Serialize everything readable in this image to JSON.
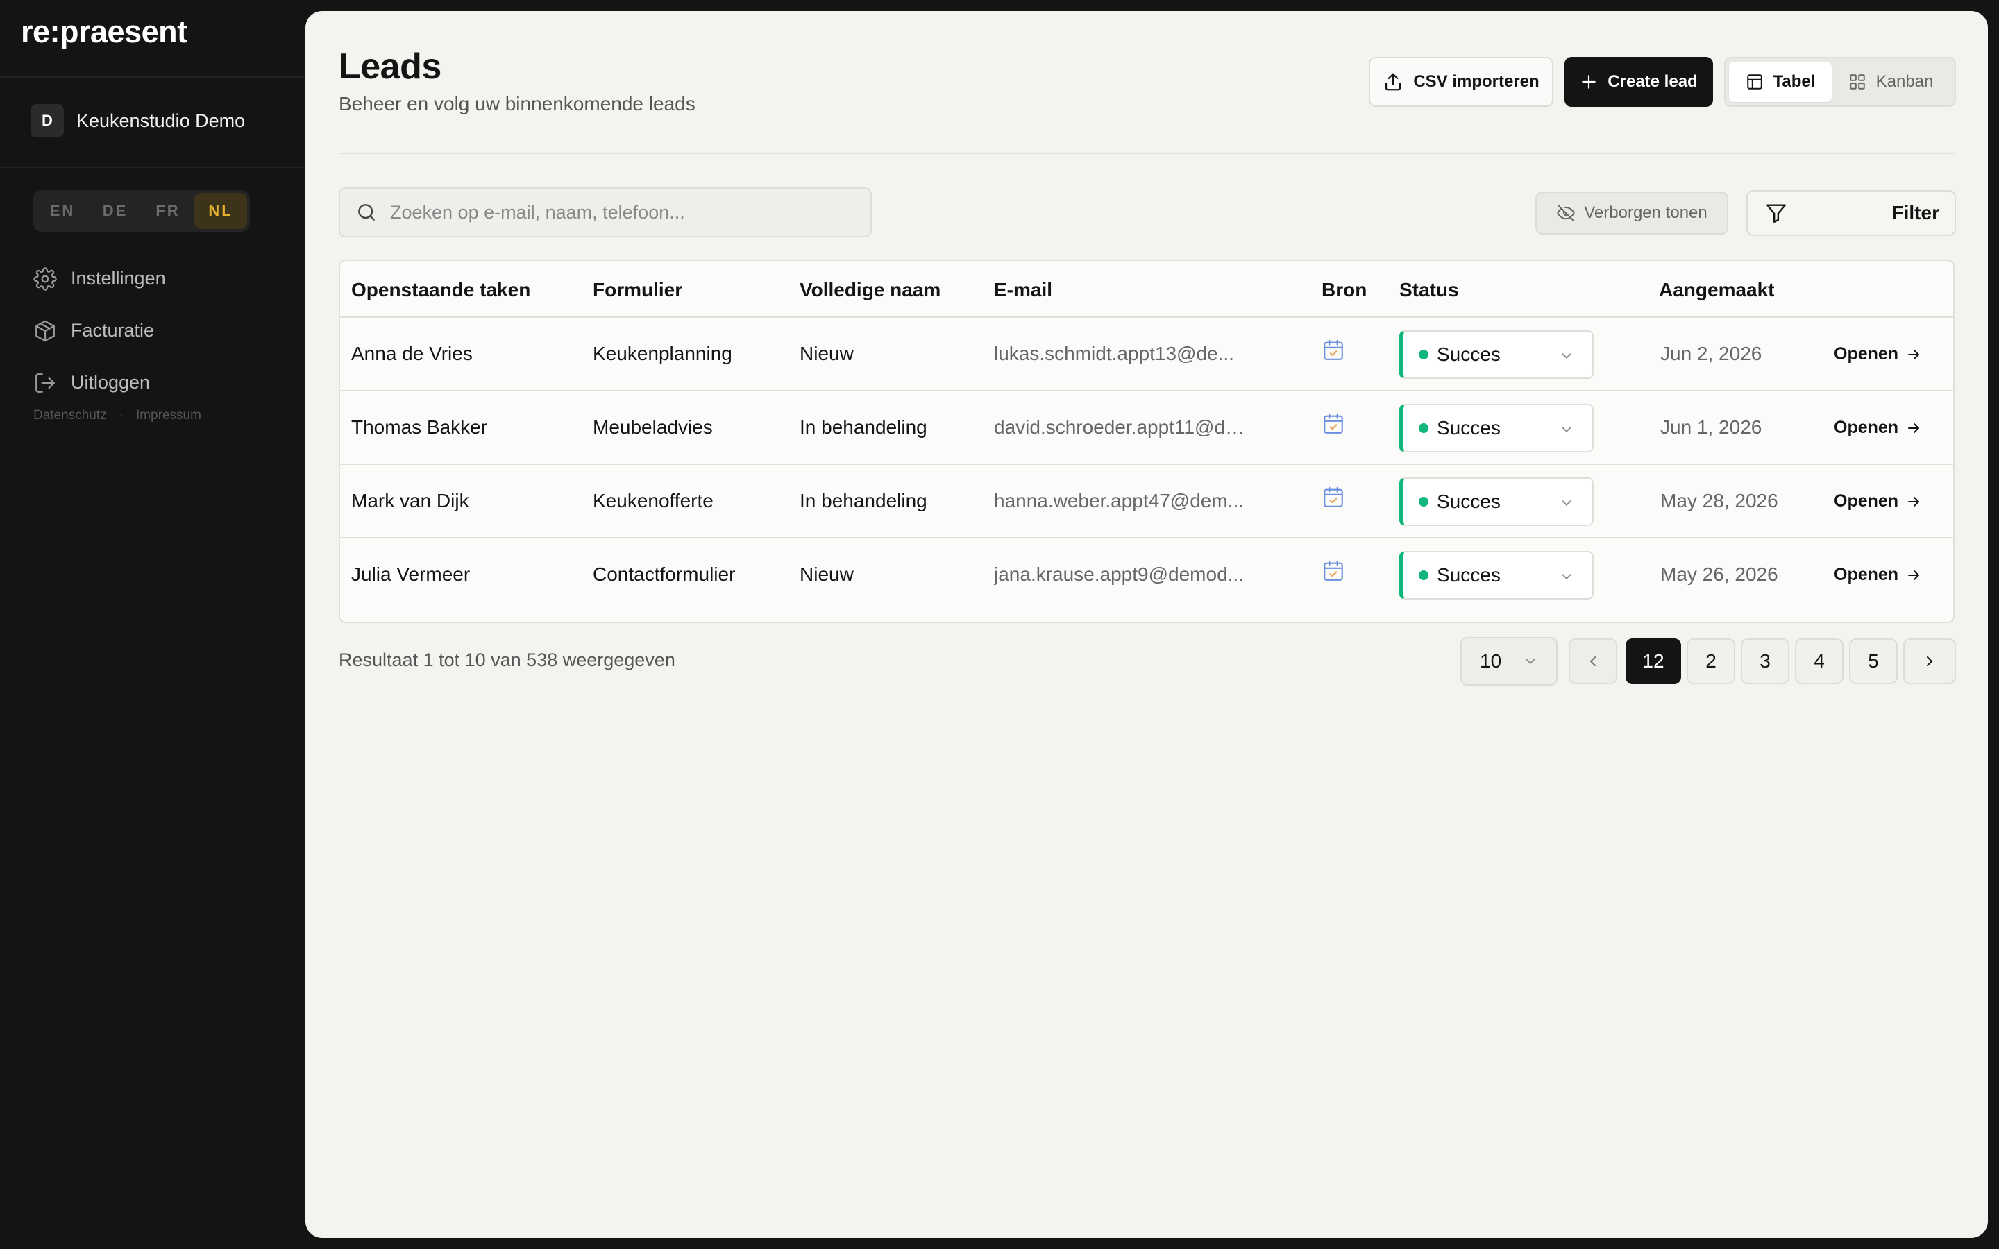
{
  "sidebar": {
    "logo": "re:praesent",
    "workspace": {
      "initial": "D",
      "name": "Keukenstudio Demo"
    },
    "languages": [
      {
        "code": "EN",
        "active": false
      },
      {
        "code": "DE",
        "active": false
      },
      {
        "code": "FR",
        "active": false
      },
      {
        "code": "NL",
        "active": true
      }
    ],
    "nav": [
      {
        "label": "Instellingen",
        "icon": "gear-icon"
      },
      {
        "label": "Facturatie",
        "icon": "box-icon"
      },
      {
        "label": "Uitloggen",
        "icon": "logout-icon"
      }
    ],
    "legal": {
      "privacy": "Datenschutz",
      "separator": "·",
      "imprint": "Impressum"
    }
  },
  "header": {
    "title": "Leads",
    "subtitle": "Beheer en volg uw binnenkomende leads",
    "csv_label": "CSV importeren",
    "create_label": "Create lead",
    "view_table": "Tabel",
    "view_kanban": "Kanban",
    "active_view": "Tabel"
  },
  "toolbar": {
    "search_placeholder": "Zoeken op e-mail, naam, telefoon...",
    "hidden_label": "Verborgen tonen",
    "filter_label": "Filter"
  },
  "table": {
    "columns": [
      "Openstaande taken",
      "Formulier",
      "Volledige naam",
      "E-mail",
      "Bron",
      "Status",
      "Aangemaakt"
    ],
    "rows": [
      {
        "taken": "Anna de Vries",
        "formulier": "Keukenplanning",
        "naam": "Nieuw",
        "email": "lukas.schmidt.appt13@de...",
        "bron_icon": "calendar-check-icon",
        "status": "Succes",
        "date": "Jun 2, 2026",
        "action": "Openen"
      },
      {
        "taken": "Thomas Bakker",
        "formulier": "Meubeladvies",
        "naam": "In behandeling",
        "email": "david.schroeder.appt11@de...",
        "bron_icon": "calendar-check-icon",
        "status": "Succes",
        "date": "Jun 1, 2026",
        "action": "Openen"
      },
      {
        "taken": "Mark van Dijk",
        "formulier": "Keukenofferte",
        "naam": "In behandeling",
        "email": "hanna.weber.appt47@dem...",
        "bron_icon": "calendar-check-icon",
        "status": "Succes",
        "date": "May 28, 2026",
        "action": "Openen"
      },
      {
        "taken": "Julia Vermeer",
        "formulier": "Contactformulier",
        "naam": "Nieuw",
        "email": "jana.krause.appt9@demod...",
        "bron_icon": "calendar-check-icon",
        "status": "Succes",
        "date": "May 26, 2026",
        "action": "Openen"
      }
    ]
  },
  "footer": {
    "result_text": "Resultaat 1 tot 10 van 538 weergegeven",
    "page_size": "10",
    "pages": [
      "12",
      "2",
      "3",
      "4",
      "5"
    ],
    "current_page": "12"
  },
  "colors": {
    "accent": "#141414",
    "status_success": "#12b67a",
    "lang_active": "#e4b12c",
    "calendar_icon": "#6b8fe0"
  }
}
